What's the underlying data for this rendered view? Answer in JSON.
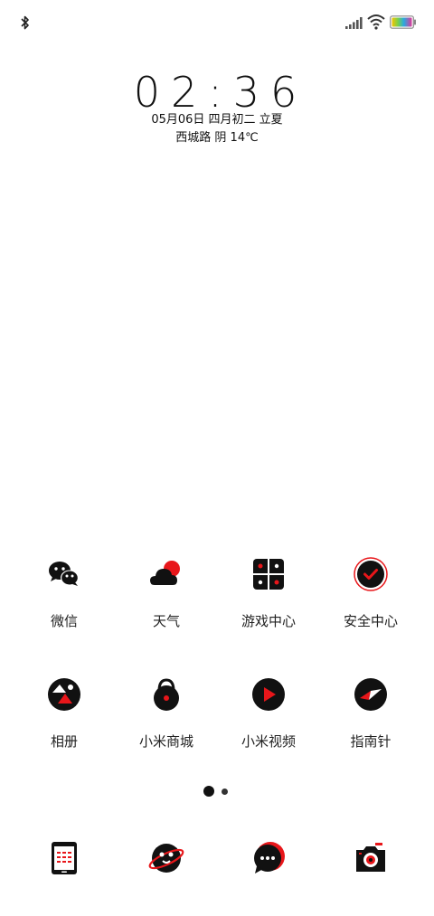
{
  "status_bar": {
    "bluetooth_icon": "bluetooth-icon",
    "signal_icon": "cell-signal-icon",
    "wifi_icon": "wifi-icon",
    "battery_icon": "battery-icon"
  },
  "lock_info": {
    "time": "02:36",
    "date": "05月06日 四月初二 立夏",
    "weather": "西城路 阴 14℃"
  },
  "apps_row1": [
    {
      "label": "微信",
      "icon": "wechat-icon"
    },
    {
      "label": "天气",
      "icon": "weather-icon"
    },
    {
      "label": "游戏中心",
      "icon": "game-center-icon"
    },
    {
      "label": "安全中心",
      "icon": "security-center-icon"
    }
  ],
  "apps_row2": [
    {
      "label": "相册",
      "icon": "gallery-icon"
    },
    {
      "label": "小米商城",
      "icon": "mi-store-icon"
    },
    {
      "label": "小米视频",
      "icon": "mi-video-icon"
    },
    {
      "label": "指南针",
      "icon": "compass-icon"
    }
  ],
  "dock": [
    {
      "icon": "calculator-icon"
    },
    {
      "icon": "browser-icon"
    },
    {
      "icon": "messages-icon"
    },
    {
      "icon": "camera-icon"
    }
  ],
  "page_indicator": {
    "current": 1,
    "total": 2
  },
  "colors": {
    "accent": "#e8161a",
    "ink": "#111111",
    "background": "#ffffff"
  }
}
